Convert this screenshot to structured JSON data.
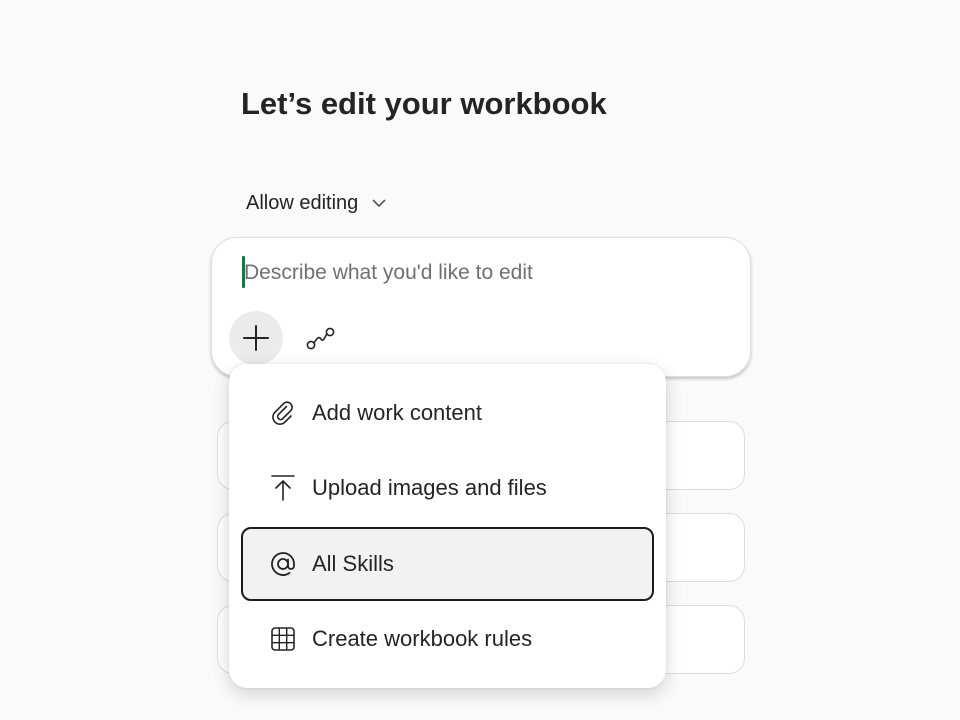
{
  "page": {
    "title": "Let’s edit your workbook"
  },
  "mode_select": {
    "label": "Allow editing",
    "icon": "chevron-down-icon"
  },
  "composer": {
    "placeholder": "Describe what you'd like to edit",
    "value": "",
    "caret_color": "#107c41",
    "plus_icon": "plus-icon",
    "agent_icon": "agent-flow-icon"
  },
  "attach_menu": {
    "items": [
      {
        "label": "Add work content",
        "icon": "paperclip-icon",
        "active": false
      },
      {
        "label": "Upload images and files",
        "icon": "upload-icon",
        "active": false
      },
      {
        "label": "All Skills",
        "icon": "at-sign-icon",
        "active": true
      },
      {
        "label": "Create workbook rules",
        "icon": "table-grid-icon",
        "active": false
      }
    ]
  },
  "suggestions": {
    "count_visible": 3
  }
}
